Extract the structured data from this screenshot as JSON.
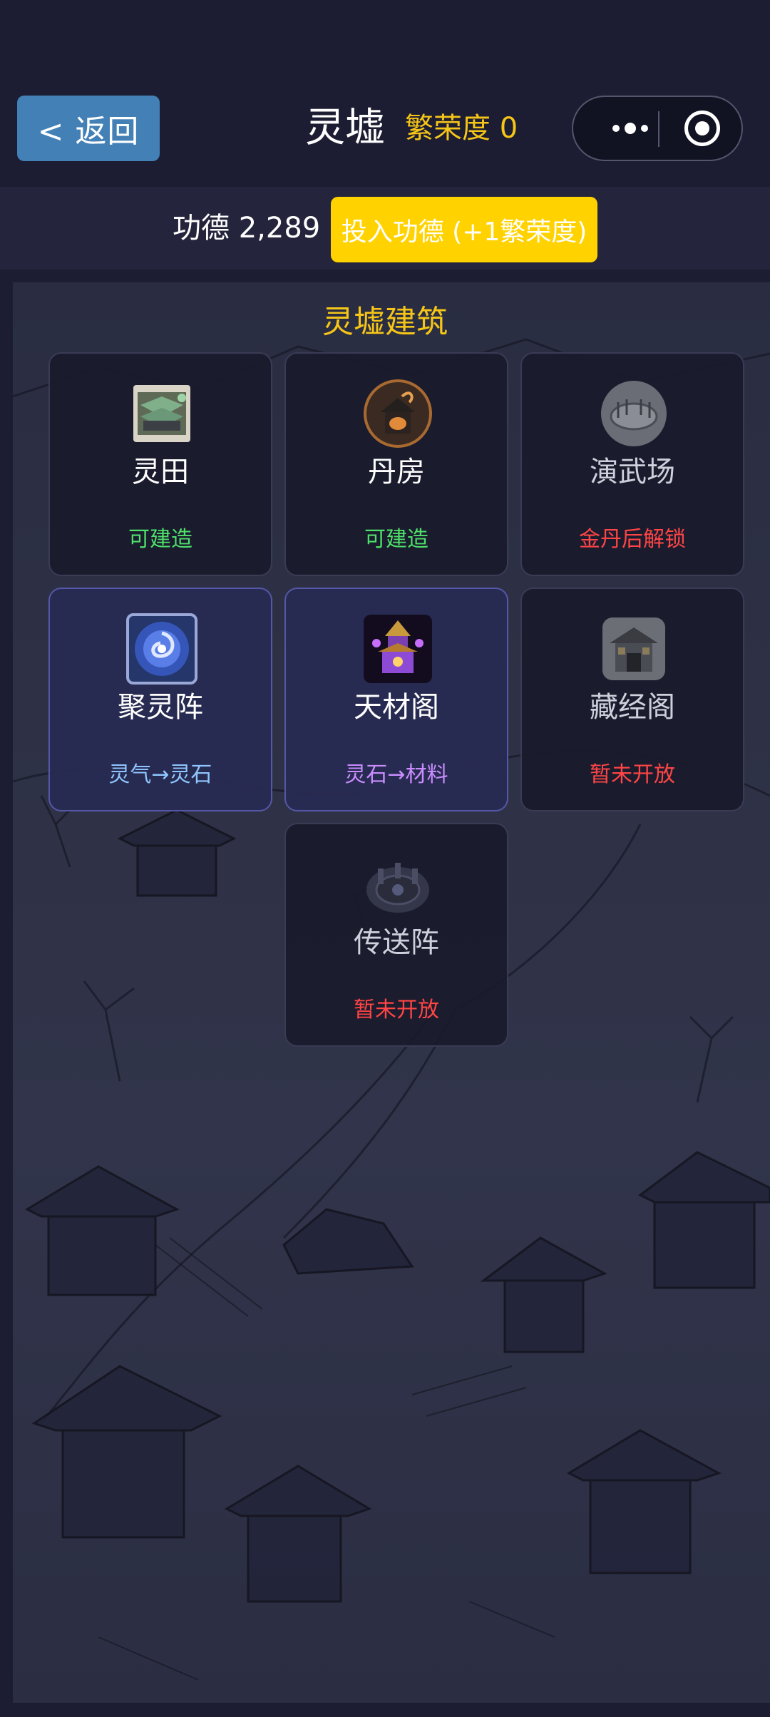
{
  "header": {
    "back_label": "< 返回",
    "title": "灵墟",
    "prosperity_text": "繁荣度 0"
  },
  "merit": {
    "text": "功德 2,289",
    "invest_label": "投入功德 (+1繁荣度)"
  },
  "section_title": "灵墟建筑",
  "buildings": [
    {
      "name": "灵田",
      "status": "可建造",
      "status_color": "#4fe06b",
      "icon": "spirit-field-icon"
    },
    {
      "name": "丹房",
      "status": "可建造",
      "status_color": "#4fe06b",
      "icon": "alchemy-room-icon"
    },
    {
      "name": "演武场",
      "status": "金丹后解锁",
      "status_color": "#ff4545",
      "icon": "training-ground-icon"
    },
    {
      "name": "聚灵阵",
      "status": "灵气→灵石",
      "status_color": "#8fc6ff",
      "icon": "spirit-array-icon"
    },
    {
      "name": "天材阁",
      "status": "灵石→材料",
      "status_color": "#c98cff",
      "icon": "material-pavilion-icon"
    },
    {
      "name": "藏经阁",
      "status": "暂未开放",
      "status_color": "#ff4545",
      "icon": "scripture-pavilion-icon"
    },
    {
      "name": "传送阵",
      "status": "暂未开放",
      "status_color": "#ff4545",
      "icon": "teleport-array-icon"
    }
  ]
}
